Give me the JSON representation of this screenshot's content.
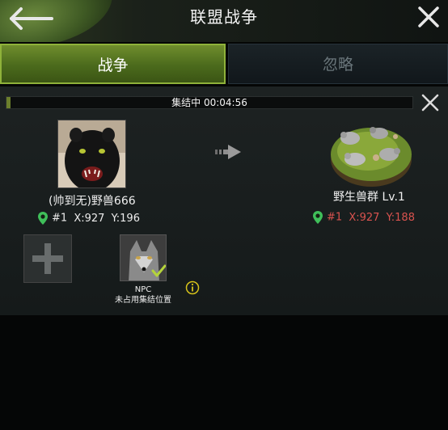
{
  "header": {
    "title": "联盟战争",
    "back_icon": "arrow-left-icon",
    "close_icon": "close-icon"
  },
  "tabs": [
    {
      "label": "战争",
      "active": true
    },
    {
      "label": "忽略",
      "active": false
    }
  ],
  "rally": {
    "status_text": "集结中 00:04:56",
    "progress": 0.01,
    "cancel_icon": "close-icon"
  },
  "attacker": {
    "name": "(帅到无)野兽666",
    "server": "#1",
    "x": "X:927",
    "y": "Y:196",
    "pin_color": "#3fbf5a"
  },
  "target": {
    "name": "野生兽群 Lv.1",
    "server": "#1",
    "x": "X:927",
    "y": "Y:188",
    "pin_color": "#3fbf5a",
    "coord_color": "#d9534f"
  },
  "slots": {
    "add_icon": "plus-icon",
    "npc_name": "NPC",
    "npc_status": "未占用集结位置",
    "check_icon": "checkmark-icon",
    "info_icon": "info-icon"
  },
  "colors": {
    "accent": "#6f8d2d",
    "tab_border": "#8fb23a"
  }
}
